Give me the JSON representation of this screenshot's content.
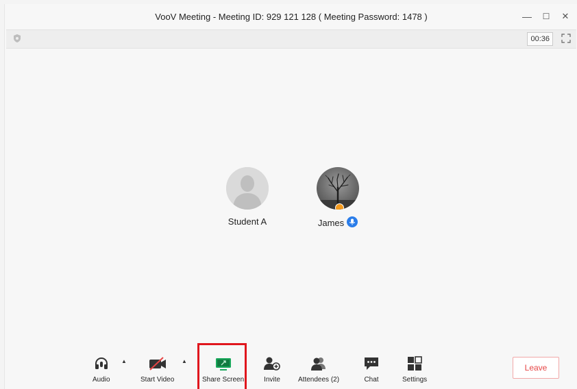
{
  "window": {
    "title": "VooV Meeting - Meeting ID: 929 121 128  ( Meeting Password: 1478 )",
    "minimize": "—",
    "maximize": "☐",
    "close": "✕"
  },
  "infobar": {
    "timer": "00:36"
  },
  "participants": [
    {
      "name": "Student A",
      "avatar": "default-person"
    },
    {
      "name": "James",
      "avatar": "tree-photo",
      "badge": "host-badge",
      "mic": "microphone-on"
    }
  ],
  "toolbar": {
    "audio": "Audio",
    "start_video": "Start Video",
    "share_screen": "Share Screen",
    "invite": "Invite",
    "attendees": "Attendees (2)",
    "chat": "Chat",
    "settings": "Settings",
    "leave": "Leave"
  },
  "colors": {
    "accent_green": "#19a85b",
    "leave_red": "#e64545",
    "highlight_red": "#e0161d",
    "mic_blue": "#2b7de9"
  }
}
